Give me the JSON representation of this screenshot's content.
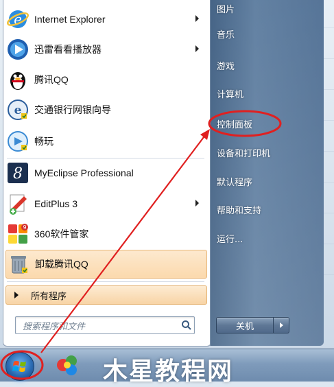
{
  "left_menu": {
    "programs": [
      {
        "label": "Internet Explorer",
        "icon": "ie-icon",
        "has_submenu": true
      },
      {
        "label": "迅雷看看播放器",
        "icon": "xunlei-player-icon",
        "has_submenu": true
      },
      {
        "label": "腾讯QQ",
        "icon": "qq-penguin-icon",
        "has_submenu": false
      },
      {
        "label": "交通银行网银向导",
        "icon": "bank-guide-icon",
        "has_submenu": false
      },
      {
        "label": "畅玩",
        "icon": "changwan-icon",
        "has_submenu": false
      },
      {
        "label": "MyEclipse Professional",
        "icon": "myeclipse-icon",
        "has_submenu": false
      },
      {
        "label": "EditPlus 3",
        "icon": "editplus-icon",
        "has_submenu": true
      },
      {
        "label": "360软件管家",
        "icon": "360-manager-icon",
        "has_submenu": false
      },
      {
        "label": "卸载腾讯QQ",
        "icon": "uninstall-icon",
        "has_submenu": false
      }
    ],
    "all_programs_label": "所有程序",
    "search_placeholder": "搜索程序和文件"
  },
  "right_menu": {
    "items": [
      {
        "label": "图片"
      },
      {
        "label": "音乐"
      },
      {
        "label": "游戏"
      },
      {
        "label": "计算机"
      },
      {
        "label": "控制面板"
      },
      {
        "label": "设备和打印机"
      },
      {
        "label": "默认程序"
      },
      {
        "label": "帮助和支持"
      },
      {
        "label": "运行..."
      }
    ],
    "shutdown_label": "关机"
  },
  "taskbar": {
    "watermark_text": "木星教程网"
  },
  "annotation": {
    "circle_color": "#e02020",
    "arrow_color": "#e02020"
  }
}
